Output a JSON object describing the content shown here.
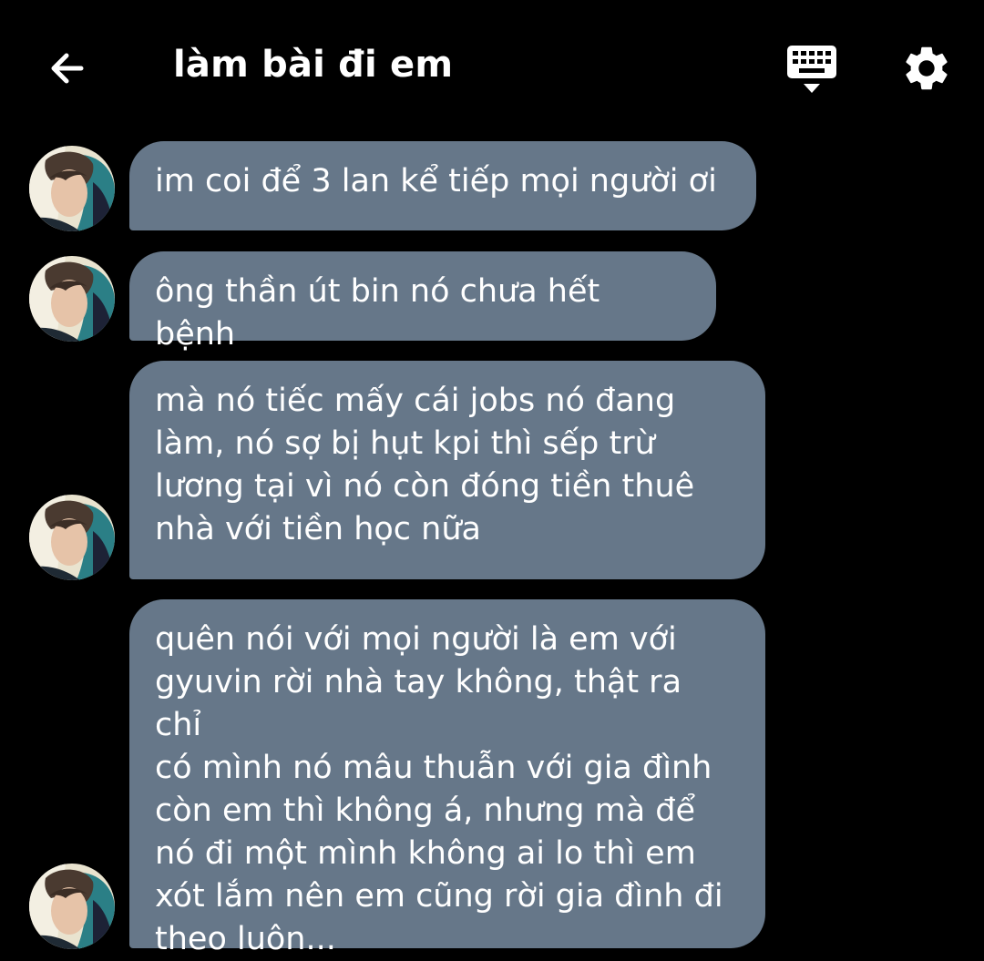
{
  "header": {
    "back_icon": "arrow-left-icon",
    "title": "làm bài đi em",
    "keyboard_icon": "keyboard-hide-icon",
    "settings_icon": "gear-icon"
  },
  "colors": {
    "background": "#000000",
    "bubble": "#667789",
    "text": "#ffffff"
  },
  "messages": [
    {
      "text": "im coi để 3 lan kể tiếp mọi người ơi"
    },
    {
      "text": "ông thần út bin nó chưa hết bệnh"
    },
    {
      "text": "mà nó tiếc mấy cái jobs nó đang\nlàm, nó sợ bị hụt kpi thì sếp trừ\nlương tại vì nó còn đóng tiền thuê\nnhà với tiền học nữa"
    },
    {
      "text": "quên nói với mọi người là em với\ngyuvin rời nhà tay không, thật ra chỉ\ncó mình nó mâu thuẫn với gia đình\ncòn em thì không á, nhưng mà để\nnó đi một mình không ai lo thì em\nxót lắm nên em cũng rời gia đình đi\ntheo luôn..."
    }
  ]
}
